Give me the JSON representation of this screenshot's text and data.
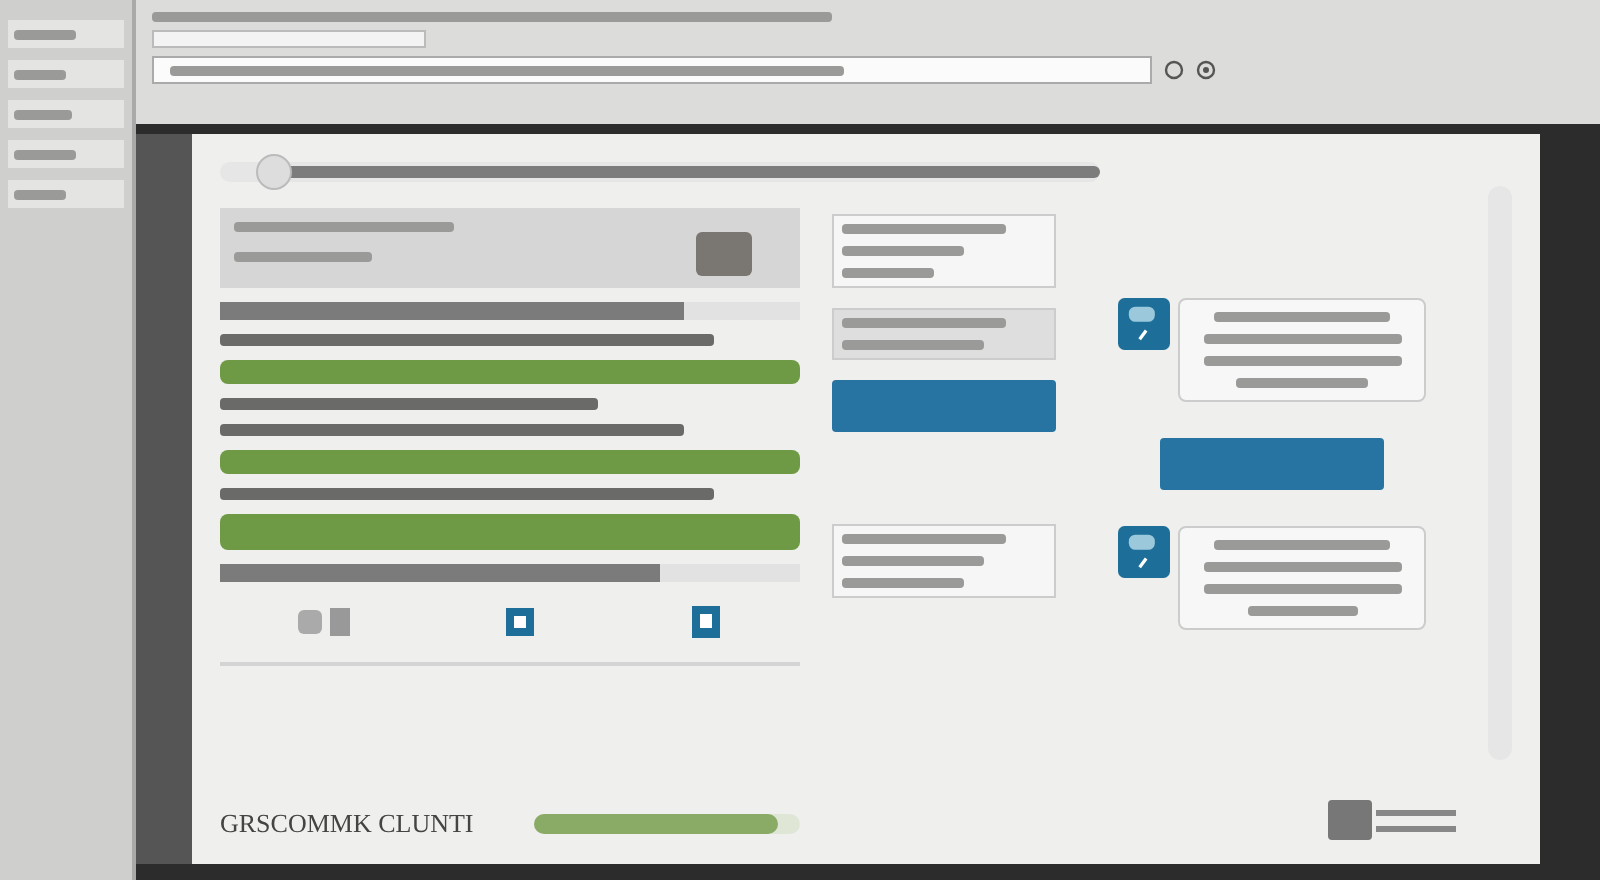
{
  "top_slider": {
    "level": 0.06
  },
  "progress_bars": [
    {
      "level": 0.8
    },
    {
      "level": 0.76
    }
  ],
  "footer_label": "GRSCOMMK CLUNTI",
  "bottom_slider": {
    "level": 0.92
  }
}
